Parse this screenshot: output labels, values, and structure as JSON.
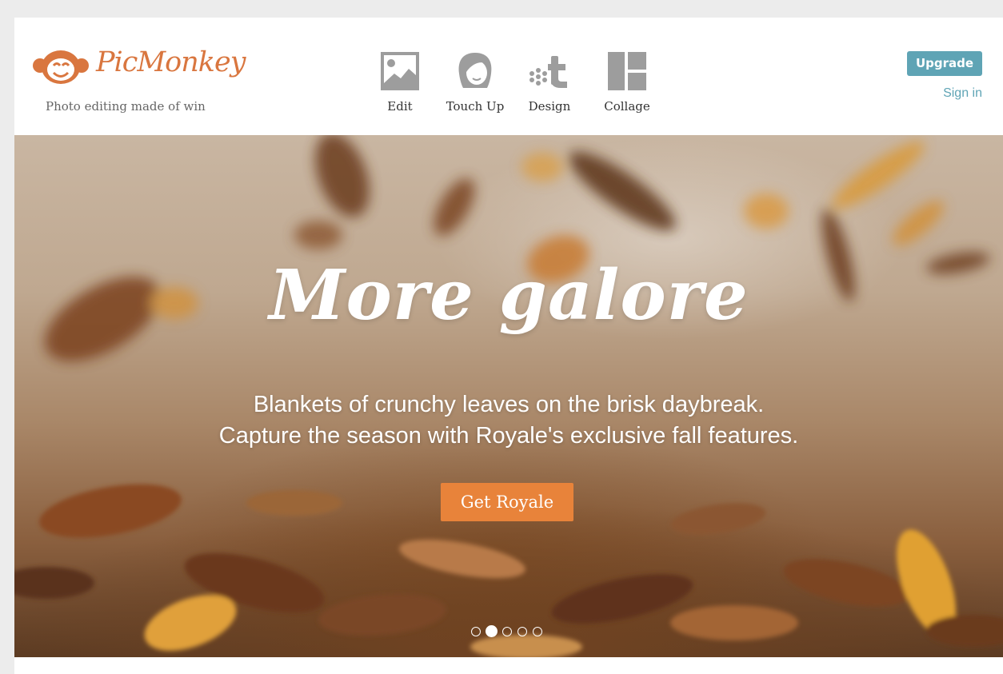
{
  "brand": {
    "name": "PicMonkey",
    "tagline": "Photo editing made of win",
    "color": "#d9763f"
  },
  "nav": {
    "items": [
      {
        "label": "Edit",
        "icon": "image-icon"
      },
      {
        "label": "Touch Up",
        "icon": "face-icon"
      },
      {
        "label": "Design",
        "icon": "design-icon"
      },
      {
        "label": "Collage",
        "icon": "collage-icon"
      }
    ]
  },
  "account": {
    "upgrade_label": "Upgrade",
    "signin_label": "Sign in",
    "accent": "#5fa4b5"
  },
  "hero": {
    "headline": "More galore",
    "subline_1": "Blankets of crunchy leaves on the brisk daybreak.",
    "subline_2": "Capture the season with Royale's exclusive fall features.",
    "cta_label": "Get Royale",
    "cta_color": "#e8833a",
    "slides": {
      "count": 5,
      "active": 2
    }
  }
}
